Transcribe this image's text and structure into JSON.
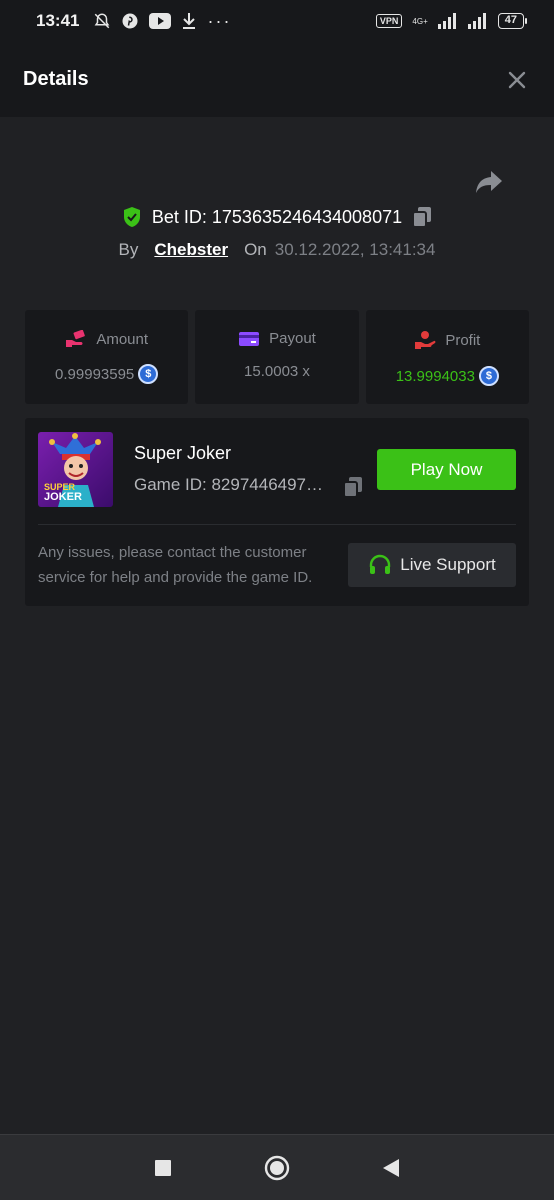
{
  "status_bar": {
    "time": "13:41",
    "vpn": "VPN",
    "network": "4G+",
    "battery": "47"
  },
  "header": {
    "title": "Details"
  },
  "bet": {
    "id_label": "Bet ID: 1753635246434008071",
    "by_label": "By",
    "user": "Chebster",
    "on_label": "On",
    "date": "30.12.2022, 13:41:34"
  },
  "stats": {
    "amount": {
      "label": "Amount",
      "value": "0.99993595"
    },
    "payout": {
      "label": "Payout",
      "value": "15.0003 x"
    },
    "profit": {
      "label": "Profit",
      "value": "13.9994033"
    }
  },
  "game": {
    "thumb_line1": "SUPER",
    "thumb_line2": "JOKER",
    "name": "Super Joker",
    "id": "Game ID: 8297446497…",
    "play_label": "Play Now",
    "support_text": "Any issues, please contact the customer service for help and provide the game ID.",
    "support_label": "Live Support"
  },
  "colors": {
    "accent_green": "#3bc117",
    "background": "#202124",
    "panel": "#17181b"
  }
}
